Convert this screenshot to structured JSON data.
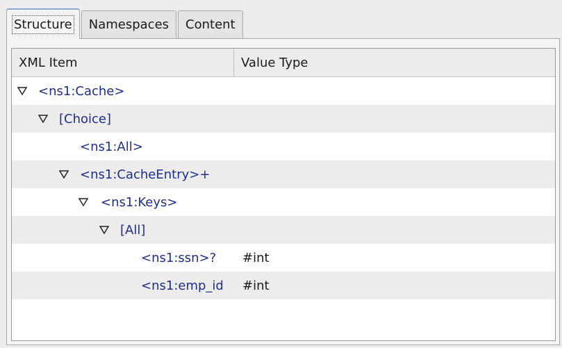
{
  "tabs": [
    {
      "label": "Structure",
      "active": true
    },
    {
      "label": "Namespaces",
      "active": false
    },
    {
      "label": "Content",
      "active": false
    }
  ],
  "columns": {
    "xml_item": "XML Item",
    "value_type": "Value Type"
  },
  "rows": [
    {
      "label": "<ns1:Cache>",
      "value_type": "",
      "expanded": true,
      "has_toggle": true,
      "level": 0
    },
    {
      "label": "[Choice]",
      "value_type": "",
      "expanded": true,
      "has_toggle": true,
      "level": 1
    },
    {
      "label": "<ns1:All>",
      "value_type": "",
      "has_toggle": false,
      "level": 2
    },
    {
      "label": "<ns1:CacheEntry>+",
      "value_type": "",
      "expanded": true,
      "has_toggle": true,
      "level": 2
    },
    {
      "label": "<ns1:Keys>",
      "value_type": "",
      "expanded": true,
      "has_toggle": true,
      "level": 3
    },
    {
      "label": "[All]",
      "value_type": "",
      "expanded": true,
      "has_toggle": true,
      "level": 4
    },
    {
      "label": "<ns1:ssn>?",
      "value_type": "#int",
      "has_toggle": false,
      "level": 5
    },
    {
      "label": "<ns1:emp_id",
      "value_type": "#int",
      "has_toggle": false,
      "level": 5
    }
  ],
  "colors": {
    "item_text": "#1e2e8a",
    "alt_row": "#ececec",
    "header_bg": "#ececec"
  }
}
